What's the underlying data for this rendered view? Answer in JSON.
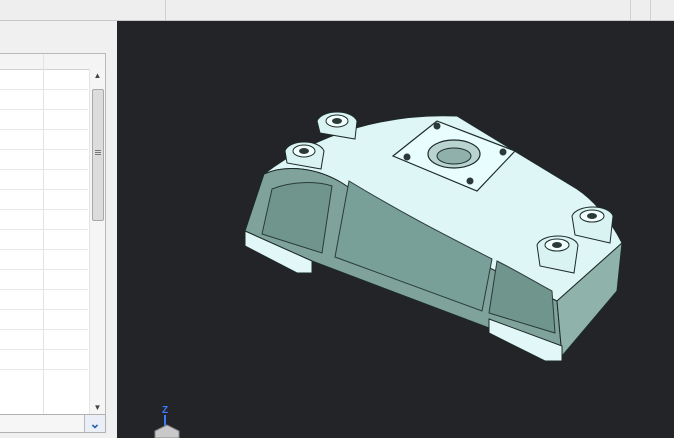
{
  "window": {
    "background": "#f0f0f0"
  },
  "viewport": {
    "background": "#222428",
    "model": {
      "name": "bearing housing",
      "face_color": "#7fa39b",
      "top_color": "#e6fbfb",
      "edge_color": "#1c2a28"
    },
    "axis_triad": {
      "z_label": "Z",
      "z_color": "#3c7bff"
    }
  },
  "left_panel": {
    "property_grid": {
      "rows": 15
    },
    "combo": {
      "dropdown_icon": "chevron-down-icon"
    }
  }
}
